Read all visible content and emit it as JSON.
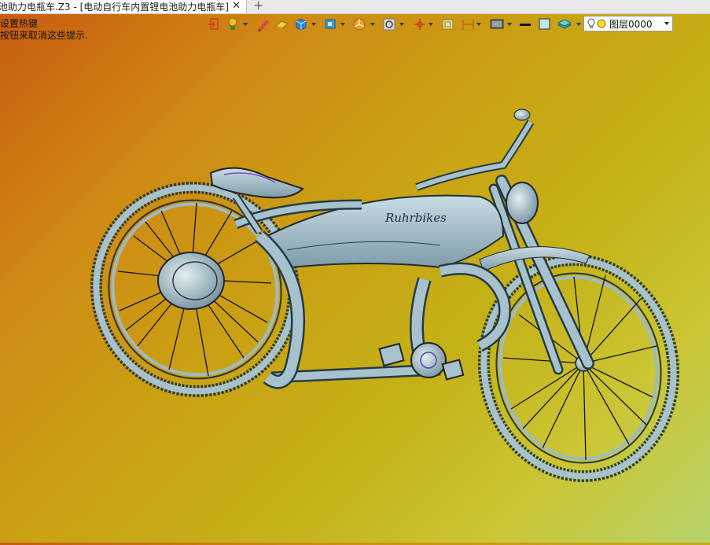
{
  "tab": {
    "title": "池助力电瓶车.Z3 - [电动自行车内置锂电池助力电瓶车]",
    "close": "✕",
    "add": "+"
  },
  "hint": {
    "line1": "设置热键",
    "line2": "按钮来取消这些提示."
  },
  "toolbar": {
    "icons": [
      "exit-icon",
      "bulb-tool-icon",
      "pen-icon",
      "eraser-icon",
      "cube-icon",
      "view-box-icon",
      "pie-tool-icon",
      "zoom-view-icon",
      "axis-icon",
      "frame-icon",
      "dimension-icon",
      "display-icon",
      "black-line-icon",
      "color-swatch-icon",
      "layers-icon",
      "bulb-icon"
    ],
    "layer": {
      "name": "图层0000"
    }
  },
  "colors": {
    "accent_bike": "#a7c2cc",
    "bg_top": "#c85a10",
    "bg_bottom": "#b6d26a"
  },
  "model": {
    "brand_script": "Ruhrbikes"
  }
}
